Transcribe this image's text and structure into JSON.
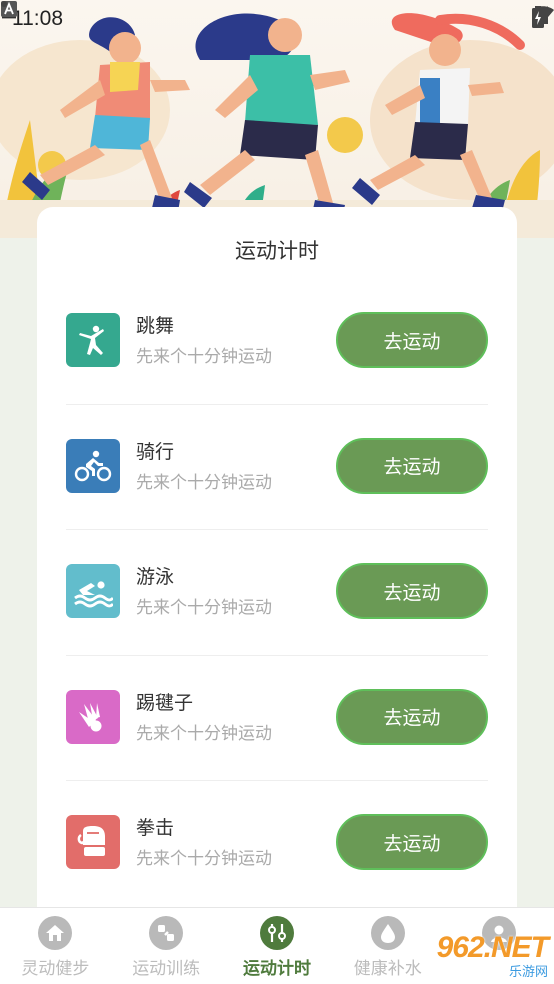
{
  "status_bar": {
    "time": "11:08"
  },
  "page": {
    "title": "运动计时"
  },
  "activities": [
    {
      "name": "跳舞",
      "subtitle": "先来个十分钟运动",
      "button": "去运动",
      "icon": "dance-icon",
      "color": "#35a88f"
    },
    {
      "name": "骑行",
      "subtitle": "先来个十分钟运动",
      "button": "去运动",
      "icon": "cycling-icon",
      "color": "#3a7db8"
    },
    {
      "name": "游泳",
      "subtitle": "先来个十分钟运动",
      "button": "去运动",
      "icon": "swimming-icon",
      "color": "#62bdcc"
    },
    {
      "name": "踢毽子",
      "subtitle": "先来个十分钟运动",
      "button": "去运动",
      "icon": "shuttlecock-icon",
      "color": "#d96ac7"
    },
    {
      "name": "拳击",
      "subtitle": "先来个十分钟运动",
      "button": "去运动",
      "icon": "boxing-icon",
      "color": "#e26d6a"
    }
  ],
  "bottom_nav": [
    {
      "label": "灵动健步",
      "icon": "home-icon",
      "active": false
    },
    {
      "label": "运动训练",
      "icon": "training-icon",
      "active": false
    },
    {
      "label": "运动计时",
      "icon": "timer-icon",
      "active": true
    },
    {
      "label": "健康补水",
      "icon": "water-drop-icon",
      "active": false
    },
    {
      "label": "",
      "icon": "profile-icon",
      "active": false
    }
  ],
  "watermark": {
    "main": "962.NET",
    "sub": "乐游网"
  },
  "colors": {
    "accent": "#6a9a55",
    "active_nav": "#4f7b3d",
    "inactive_nav": "#bcbcbc"
  }
}
